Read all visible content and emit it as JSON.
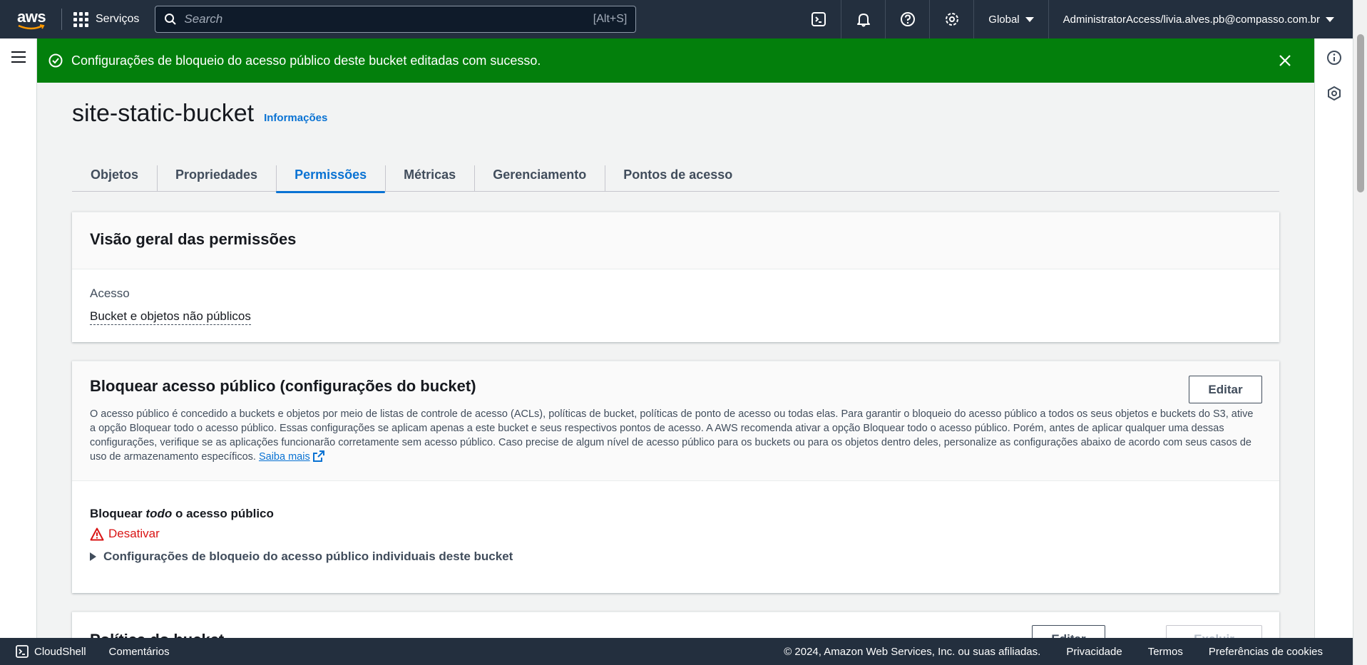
{
  "topnav": {
    "logo_text": "aws",
    "services_label": "Serviços",
    "search_placeholder": "Search",
    "search_shortcut": "[Alt+S]",
    "region": "Global",
    "account": "AdministratorAccess/livia.alves.pb@compasso.com.br"
  },
  "flash": {
    "message": "Configurações de bloqueio do acesso público deste bucket editadas com sucesso.",
    "color": "#037f0c"
  },
  "page": {
    "title": "site-static-bucket",
    "info_link": "Informações"
  },
  "tabs": [
    {
      "label": "Objetos",
      "active": false
    },
    {
      "label": "Propriedades",
      "active": false
    },
    {
      "label": "Permissões",
      "active": true
    },
    {
      "label": "Métricas",
      "active": false
    },
    {
      "label": "Gerenciamento",
      "active": false
    },
    {
      "label": "Pontos de acesso",
      "active": false
    }
  ],
  "overview": {
    "title": "Visão geral das permissões",
    "access_label": "Acesso",
    "access_value": "Bucket e objetos não públicos"
  },
  "block_public": {
    "title": "Bloquear acesso público (configurações do bucket)",
    "edit_label": "Editar",
    "description": "O acesso público é concedido a buckets e objetos por meio de listas de controle de acesso (ACLs), políticas de bucket, políticas de ponto de acesso ou todas elas. Para garantir o bloqueio do acesso público a todos os seus objetos e buckets do S3, ative a opção Bloquear todo o acesso público. Essas configurações se aplicam apenas a este bucket e seus respectivos pontos de acesso. A AWS recomenda ativar a opção Bloquear todo o acesso público. Porém, antes de aplicar qualquer uma dessas configurações, verifique se as aplicações funcionarão corretamente sem acesso público. Caso precise de algum nível de acesso público para os buckets ou para os objetos dentro deles, personalize as configurações abaixo de acordo com seus casos de uso de armazenamento específicos.",
    "learn_more": "Saiba mais",
    "block_all_prefix": "Bloquear ",
    "block_all_em": "todo",
    "block_all_suffix": " o acesso público",
    "status": "Desativar",
    "expander": "Configurações de bloqueio do acesso público individuais deste bucket"
  },
  "bucket_policy": {
    "title": "Política do bucket",
    "edit_label": "Editar",
    "delete_label": "Excluir"
  },
  "footer": {
    "cloudshell": "CloudShell",
    "feedback": "Comentários",
    "copyright": "© 2024, Amazon Web Services, Inc. ou suas afiliadas.",
    "privacy": "Privacidade",
    "terms": "Termos",
    "cookies": "Preferências de cookies"
  }
}
